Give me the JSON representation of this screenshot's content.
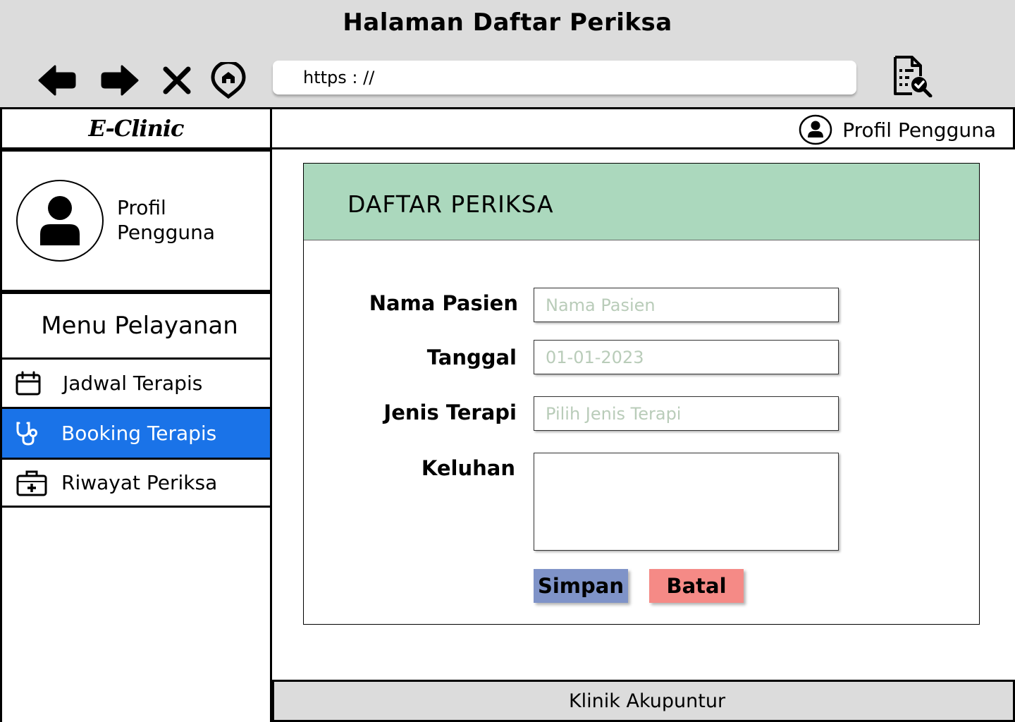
{
  "window": {
    "title": "Halaman Daftar Periksa"
  },
  "browser": {
    "back_icon": "arrow-left-icon",
    "forward_icon": "arrow-right-icon",
    "stop_icon": "close-icon",
    "home_icon": "home-icon",
    "url": "https : //",
    "report_icon": "document-check-icon"
  },
  "brand": {
    "name": "E-Clinic"
  },
  "topbar": {
    "user_label": "Profil Pengguna",
    "user_icon": "user-circle-icon"
  },
  "sidebar": {
    "profile": {
      "name_line1": "Profil",
      "name_line2": "Pengguna",
      "icon": "user-avatar-icon"
    },
    "menu_header": "Menu Pelayanan",
    "items": [
      {
        "label": "Jadwal Terapis",
        "icon": "calendar-icon",
        "active": false
      },
      {
        "label": "Booking Terapis",
        "icon": "stethoscope-icon",
        "active": true
      },
      {
        "label": "Riwayat Periksa",
        "icon": "medical-kit-icon",
        "active": false
      }
    ]
  },
  "form": {
    "title": "DAFTAR PERIKSA",
    "fields": {
      "nama": {
        "label": "Nama Pasien",
        "placeholder": "Nama Pasien"
      },
      "tanggal": {
        "label": "Tanggal",
        "placeholder": "01-01-2023"
      },
      "jenis": {
        "label": "Jenis Terapi",
        "placeholder": "Pilih Jenis Terapi"
      },
      "keluhan": {
        "label": "Keluhan",
        "placeholder": ""
      }
    },
    "save_label": "Simpan",
    "cancel_label": "Batal"
  },
  "footer": {
    "text": "Klinik Akupuntur"
  },
  "colors": {
    "chrome": "#dcdcdc",
    "header_green": "#abd8bd",
    "active_menu": "#1a73e8",
    "save_button": "#7f93c8",
    "cancel_button": "#f58a86",
    "placeholder": "#b9ccb9"
  }
}
